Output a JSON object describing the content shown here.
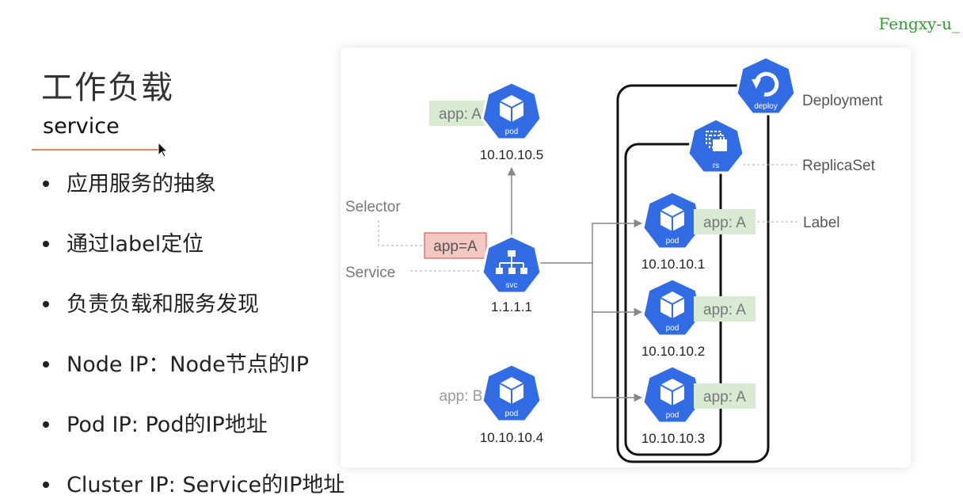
{
  "watermark": "Fengxy-u_",
  "title": "工作负载",
  "subtitle": "service",
  "bullets": [
    "应用服务的抽象",
    "通过label定位",
    "负责负载和服务发现",
    "Node IP：Node节点的IP",
    "Pod IP: Pod的IP地址",
    "Cluster IP: Service的IP地址"
  ],
  "diagram": {
    "labels": {
      "deployment": "Deployment",
      "replicaset": "ReplicaSet",
      "label": "Label",
      "selector": "Selector",
      "service": "Service",
      "selector_value": "app=A"
    },
    "icons": {
      "deploy": "deploy",
      "rs": "rs",
      "svc": "svc",
      "pod": "pod"
    },
    "service_ip": "1.1.1.1",
    "pods": [
      {
        "tag": "app: A",
        "ip": "10.10.10.5"
      },
      {
        "tag": "app: B",
        "ip": "10.10.10.4"
      },
      {
        "tag": "app: A",
        "ip": "10.10.10.1"
      },
      {
        "tag": "app: A",
        "ip": "10.10.10.2"
      },
      {
        "tag": "app: A",
        "ip": "10.10.10.3"
      }
    ],
    "colors": {
      "k8s_blue": "#326ce5",
      "tag_green": "#d9ead3",
      "selector_red": "#f4c7c3"
    }
  }
}
